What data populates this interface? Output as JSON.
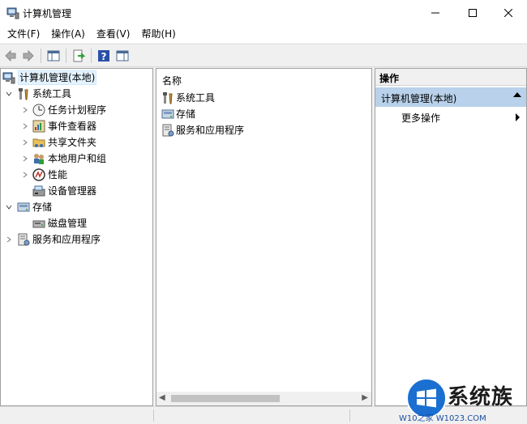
{
  "window": {
    "title": "计算机管理",
    "minimize_glyph": "—",
    "maximize_glyph": "☐",
    "close_glyph": "✕"
  },
  "menu": [
    "文件(F)",
    "操作(A)",
    "查看(V)",
    "帮助(H)"
  ],
  "toolbar": {
    "buttons": [
      "back-icon",
      "forward-icon",
      "show-hide-tree-icon",
      "export-list-icon",
      "help-icon",
      "show-hide-action-pane-icon"
    ]
  },
  "tree": {
    "root": "计算机管理(本地)",
    "system_tools": "系统工具",
    "task_scheduler": "任务计划程序",
    "event_viewer": "事件查看器",
    "shared_folders": "共享文件夹",
    "local_users": "本地用户和组",
    "performance": "性能",
    "device_manager": "设备管理器",
    "storage": "存储",
    "disk_management": "磁盘管理",
    "services_apps": "服务和应用程序"
  },
  "list": {
    "header": "名称",
    "items": [
      "系统工具",
      "存储",
      "服务和应用程序"
    ]
  },
  "actions": {
    "header": "操作",
    "group": "计算机管理(本地)",
    "more": "更多操作"
  },
  "watermark": {
    "brand": "系统族",
    "url": "W10之家 W1023.COM"
  },
  "colors": {
    "selection": "#e5f3ff",
    "action_group": "#b9d1ea",
    "watermark_blue": "#1a6fd1"
  }
}
